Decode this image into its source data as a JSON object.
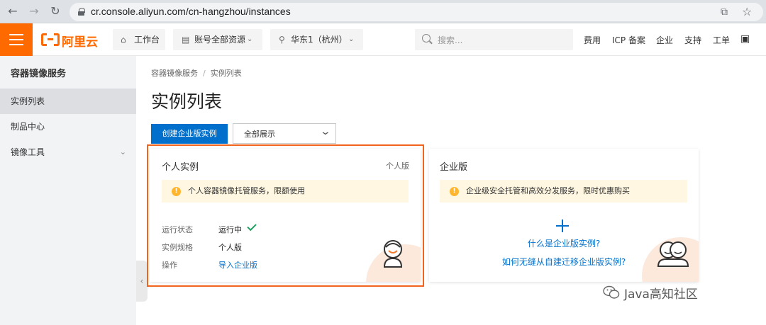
{
  "browser": {
    "url": "cr.console.aliyun.com/cn-hangzhou/instances",
    "icons": [
      "back-icon",
      "forward-icon",
      "reload-icon",
      "lock-icon",
      "share-icon",
      "star-icon"
    ]
  },
  "topnav": {
    "brand": "阿里云",
    "workbench": "工作台",
    "account_resources": "账号全部资源",
    "region": "华东1（杭州）",
    "search_placeholder": "搜索...",
    "links": [
      "费用",
      "ICP 备案",
      "企业",
      "支持",
      "工单"
    ],
    "accent_color": "#ff6a00"
  },
  "sidebar": {
    "title": "容器镜像服务",
    "items": [
      {
        "label": "实例列表",
        "active": true
      },
      {
        "label": "制品中心",
        "active": false
      },
      {
        "label": "镜像工具",
        "active": false,
        "expandable": true
      }
    ]
  },
  "main": {
    "breadcrumb": [
      "容器镜像服务",
      "实例列表"
    ],
    "breadcrumb_sep": "/",
    "title": "实例列表",
    "create_button": "创建企业版实例",
    "filter_select": "全部展示",
    "primary_color": "#0070cc"
  },
  "cards": {
    "personal": {
      "title": "个人实例",
      "tag": "个人版",
      "notice": "个人容器镜像托管服务，限额使用",
      "rows": [
        {
          "label": "运行状态",
          "value": "运行中"
        },
        {
          "label": "实例规格",
          "value": "个人版"
        },
        {
          "label": "操作",
          "value": "导入企业版"
        }
      ],
      "highlight_color": "#f0641e"
    },
    "enterprise": {
      "title": "企业版",
      "notice": "企业级安全托管和高效分发服务，限时优惠购买",
      "link1": "什么是企业版实例?",
      "link2": "如何无缝从自建迁移企业版实例?"
    }
  },
  "watermark": "Java高知社区"
}
